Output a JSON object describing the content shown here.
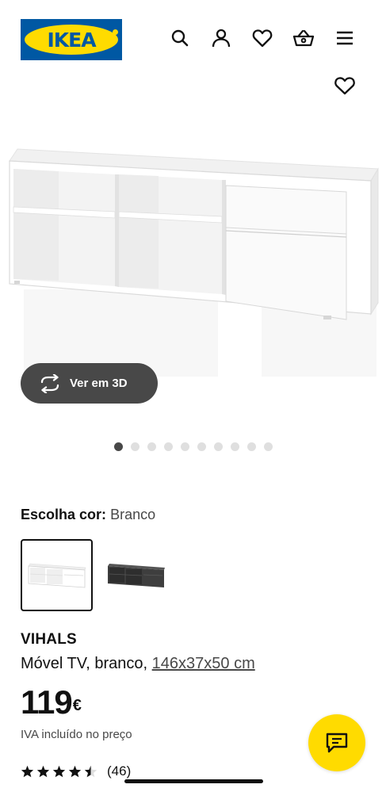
{
  "header": {
    "logo_text": "IKEA",
    "icons": [
      "search-icon",
      "user-icon",
      "heart-icon",
      "basket-icon",
      "menu-icon"
    ]
  },
  "gallery": {
    "view_3d_label": "Ver em 3D",
    "image_count": 10,
    "active_image_index": 0
  },
  "color_choice": {
    "label": "Escolha cor:",
    "selected": "Branco",
    "options": [
      "Branco",
      "Cinzento escuro"
    ]
  },
  "product": {
    "name": "VIHALS",
    "description": "Móvel TV, branco,",
    "dimensions": "146x37x50 cm",
    "price_value": "119",
    "price_currency": "€",
    "vat_note": "IVA incluído no preço",
    "rating_stars": 4.5,
    "review_count": "(46)"
  },
  "colors": {
    "ikea_blue": "#0058a3",
    "ikea_yellow": "#ffdb00",
    "dark_button": "#484848"
  }
}
